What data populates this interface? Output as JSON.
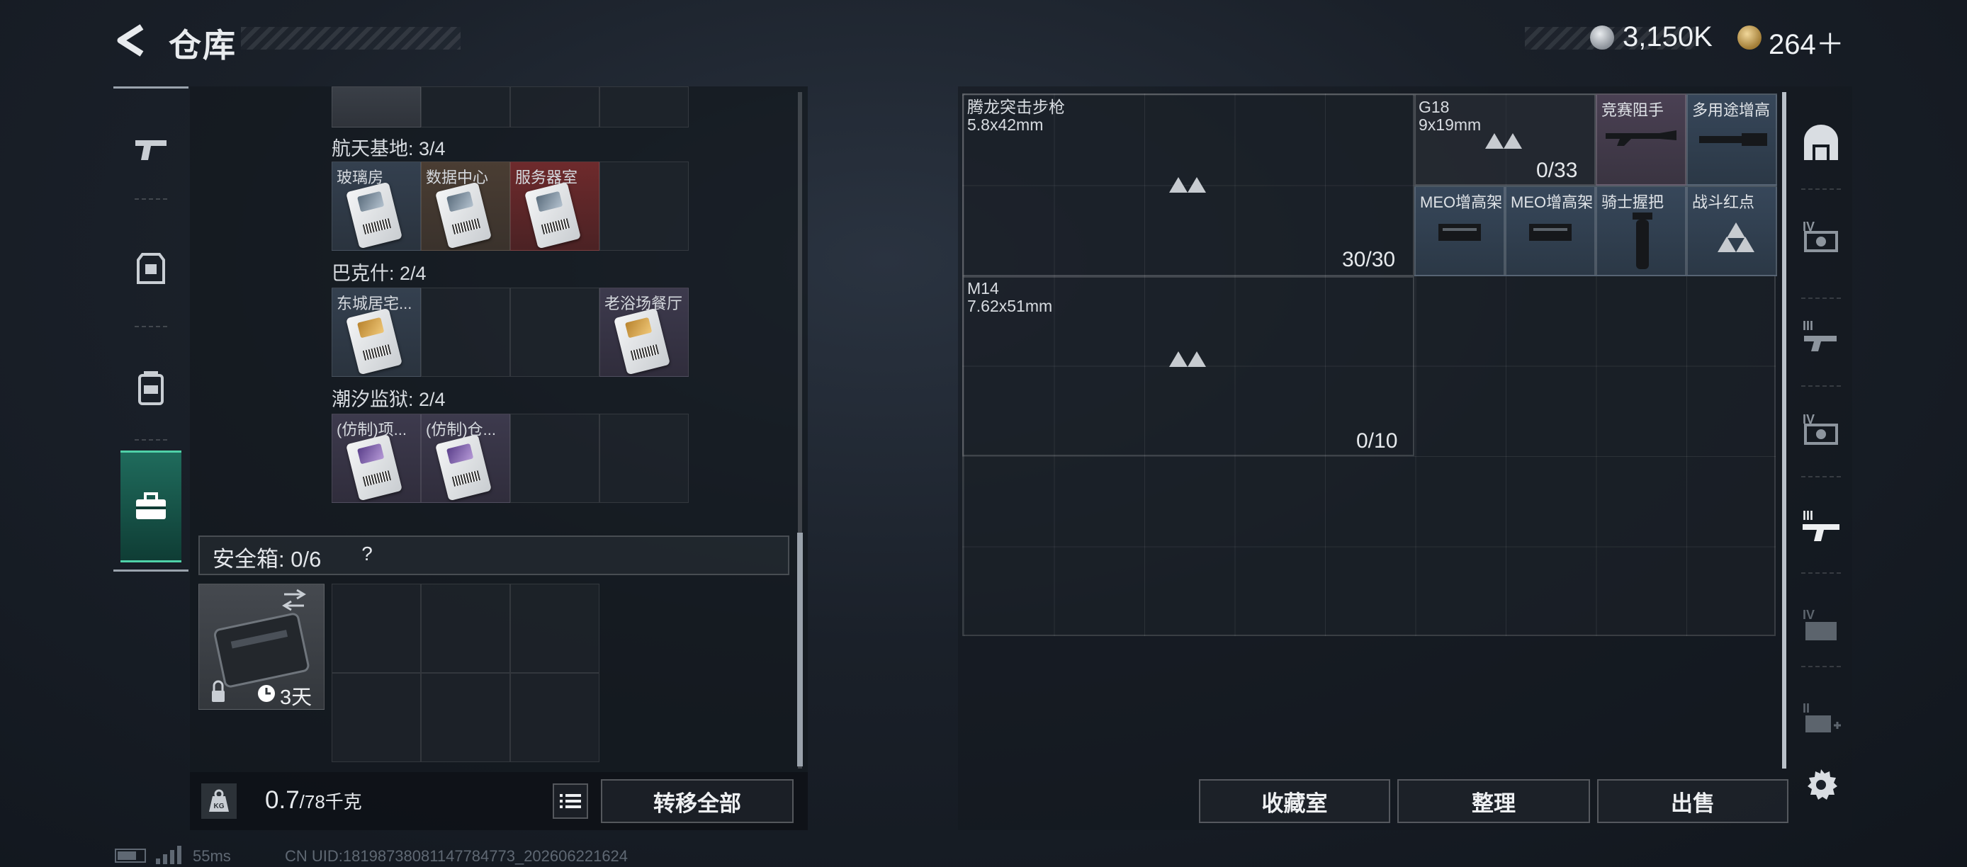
{
  "header": {
    "title": "仓库",
    "currency_silver": "3,150K",
    "currency_gold": "264＋"
  },
  "left_tabs": [
    "pistol-tab",
    "armor-tab",
    "backpack-tab",
    "case-tab"
  ],
  "stash": {
    "sections": [
      {
        "title": "航天基地: 3/4",
        "items": [
          "玻璃房",
          "数据中心",
          "服务器室",
          ""
        ]
      },
      {
        "title": "巴克什: 2/4",
        "items": [
          "东城居宅...",
          "",
          "",
          "老浴场餐厅"
        ]
      },
      {
        "title": "潮汐监狱: 2/4",
        "items": [
          "(仿制)项...",
          "(仿制)仓...",
          "",
          ""
        ]
      }
    ],
    "safe_label": "安全箱: 0/6",
    "help": "?",
    "safebox_timer": "3天",
    "weight_current": "0.7",
    "weight_max": "/78千克",
    "transfer_all": "转移全部"
  },
  "storage": {
    "weapons": [
      {
        "name": "腾龙突击步枪",
        "caliber": "5.8x42mm",
        "count": "30/30"
      },
      {
        "name": "G18",
        "caliber": "9x19mm",
        "count": "0/33"
      },
      {
        "name": "M14",
        "caliber": "7.62x51mm",
        "count": "0/10"
      }
    ],
    "attachments": [
      "竞赛阻手",
      "多用途增高",
      "MEO增高架",
      "MEO增高架",
      "骑士握把",
      "战斗红点"
    ]
  },
  "buttons": {
    "collection": "收藏室",
    "sort": "整理",
    "sell": "出售"
  },
  "status": {
    "ping": "55ms",
    "uid": "CN UID:18198738081147784773_202606221624"
  }
}
